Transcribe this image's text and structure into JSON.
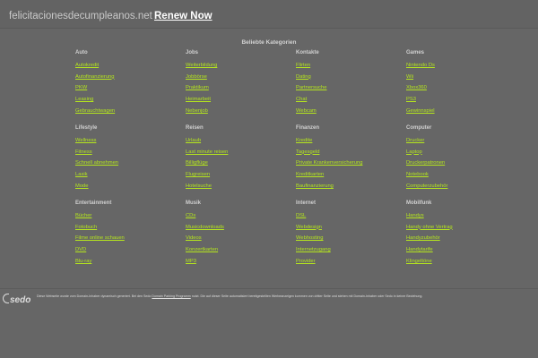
{
  "header": {
    "domain": "felicitacionesdecumpleanos.net",
    "renew_label": "Renew Now"
  },
  "panel_title": "Beliebte Kategorien",
  "categories": [
    {
      "title": "Auto",
      "links": [
        "Autokredit",
        "Autofinanzierung",
        "PKW",
        "Leasing",
        "Gebrauchtwagen"
      ]
    },
    {
      "title": "Jobs",
      "links": [
        "Weiterbildung",
        "Jobbörse",
        "Praktikum",
        "Heimarbeit",
        "Nebenjob"
      ]
    },
    {
      "title": "Kontakte",
      "links": [
        "Flirten",
        "Dating",
        "Partnersuche",
        "Chat",
        "Webcam"
      ]
    },
    {
      "title": "Games",
      "links": [
        "Nintendo Ds",
        "Wii",
        "Xbox360",
        "PS3",
        "Gewinnspiel"
      ]
    },
    {
      "title": "Lifestyle",
      "links": [
        "Wellness",
        "Fitness",
        "Schnell abnehmen",
        "Lasik",
        "Mode"
      ]
    },
    {
      "title": "Reisen",
      "links": [
        "Urlaub",
        "Last minute reisen",
        "Billigflüge",
        "Flugreisen",
        "Hotelsuche"
      ]
    },
    {
      "title": "Finanzen",
      "links": [
        "Kredite",
        "Tagesgeld",
        "Private Krankenversicherung",
        "Kreditkarten",
        "Baufinanzierung"
      ]
    },
    {
      "title": "Computer",
      "links": [
        "Drucker",
        "Laptop",
        "Druckerpatronen",
        "Notebook",
        "Computerzubehör"
      ]
    },
    {
      "title": "Entertainment",
      "links": [
        "Bücher",
        "Fotobuch",
        "Filme online schauen",
        "DVD",
        "Blu-ray"
      ]
    },
    {
      "title": "Musik",
      "links": [
        "CDs",
        "Musicdownloads",
        "Videos",
        "Konzertkarten",
        "MP3"
      ]
    },
    {
      "title": "Internet",
      "links": [
        "DSL",
        "Webdesign",
        "Webhosting",
        "Internetzugang",
        "Provider"
      ]
    },
    {
      "title": "Mobilfunk",
      "links": [
        "Handys",
        "Handy ohne Vertrag",
        "Handyzubehör",
        "Handytarife",
        "Klingeltöne"
      ]
    }
  ],
  "footer": {
    "logo_text": "sedo",
    "disclaimer_before": "Diese Webseite wurde vom Domain-Inhaber dynamisch generiert. Bei den Sedo",
    "disclaimer_link": "Domain Parking Programm",
    "disclaimer_after": "nutzt. Die auf dieser Seite automatisiert bereitgestellten Werbeanzeigen kommen von dritter Seite und stehen mit Domain-Inhaber oder Sedo in keiner Beziehung."
  },
  "colors": {
    "background": "#666666",
    "link": "#b5e61d",
    "heading": "#d0d0d0"
  }
}
